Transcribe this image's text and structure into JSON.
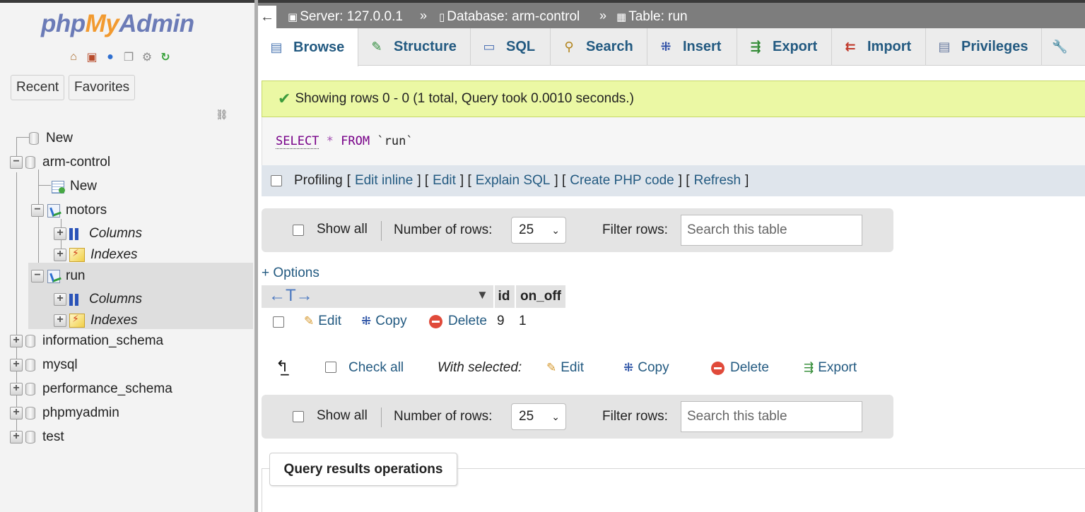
{
  "nav": {
    "logo_php": "php",
    "logo_my": "My",
    "logo_admin": "Admin",
    "tabs": {
      "recent": "Recent",
      "favorites": "Favorites"
    },
    "tree": {
      "new_top": "New",
      "db_arm": "arm-control",
      "new_table": "New",
      "motors": "motors",
      "columns": "Columns",
      "indexes": "Indexes",
      "run": "run",
      "db_info": "information_schema",
      "db_mysql": "mysql",
      "db_perf": "performance_schema",
      "db_pma": "phpmyadmin",
      "db_test": "test"
    }
  },
  "topbar": {
    "back": "←",
    "server": "Server: 127.0.0.1",
    "database": "Database: arm-control",
    "table": "Table: run",
    "sep": "»"
  },
  "tabs": {
    "browse": "Browse",
    "structure": "Structure",
    "sql": "SQL",
    "search": "Search",
    "insert": "Insert",
    "export": "Export",
    "import": "Import",
    "privileges": "Privileges"
  },
  "result": {
    "message": "Showing rows 0 - 0 (1 total, Query took 0.0010 seconds.)",
    "sql_select": "SELECT",
    "sql_star": "*",
    "sql_from": "FROM",
    "sql_table": "`run`"
  },
  "profiling": {
    "label": "Profiling",
    "edit_inline": "Edit inline",
    "edit": "Edit",
    "explain": "Explain SQL",
    "php": "Create PHP code",
    "refresh": "Refresh"
  },
  "navbar": {
    "show_all": "Show all",
    "number_of_rows": "Number of rows:",
    "rows_value": "25",
    "filter_rows": "Filter rows:",
    "search_placeholder": "Search this table"
  },
  "table": {
    "options": "+ Options",
    "col_id": "id",
    "col_onoff": "on_off",
    "row_edit": "Edit",
    "row_copy": "Copy",
    "row_delete": "Delete",
    "row_id": "9",
    "row_onoff": "1"
  },
  "bulk": {
    "check_all": "Check all",
    "with_selected": "With selected:",
    "edit": "Edit",
    "copy": "Copy",
    "delete": "Delete",
    "export": "Export"
  },
  "ops": {
    "title": "Query results operations"
  }
}
